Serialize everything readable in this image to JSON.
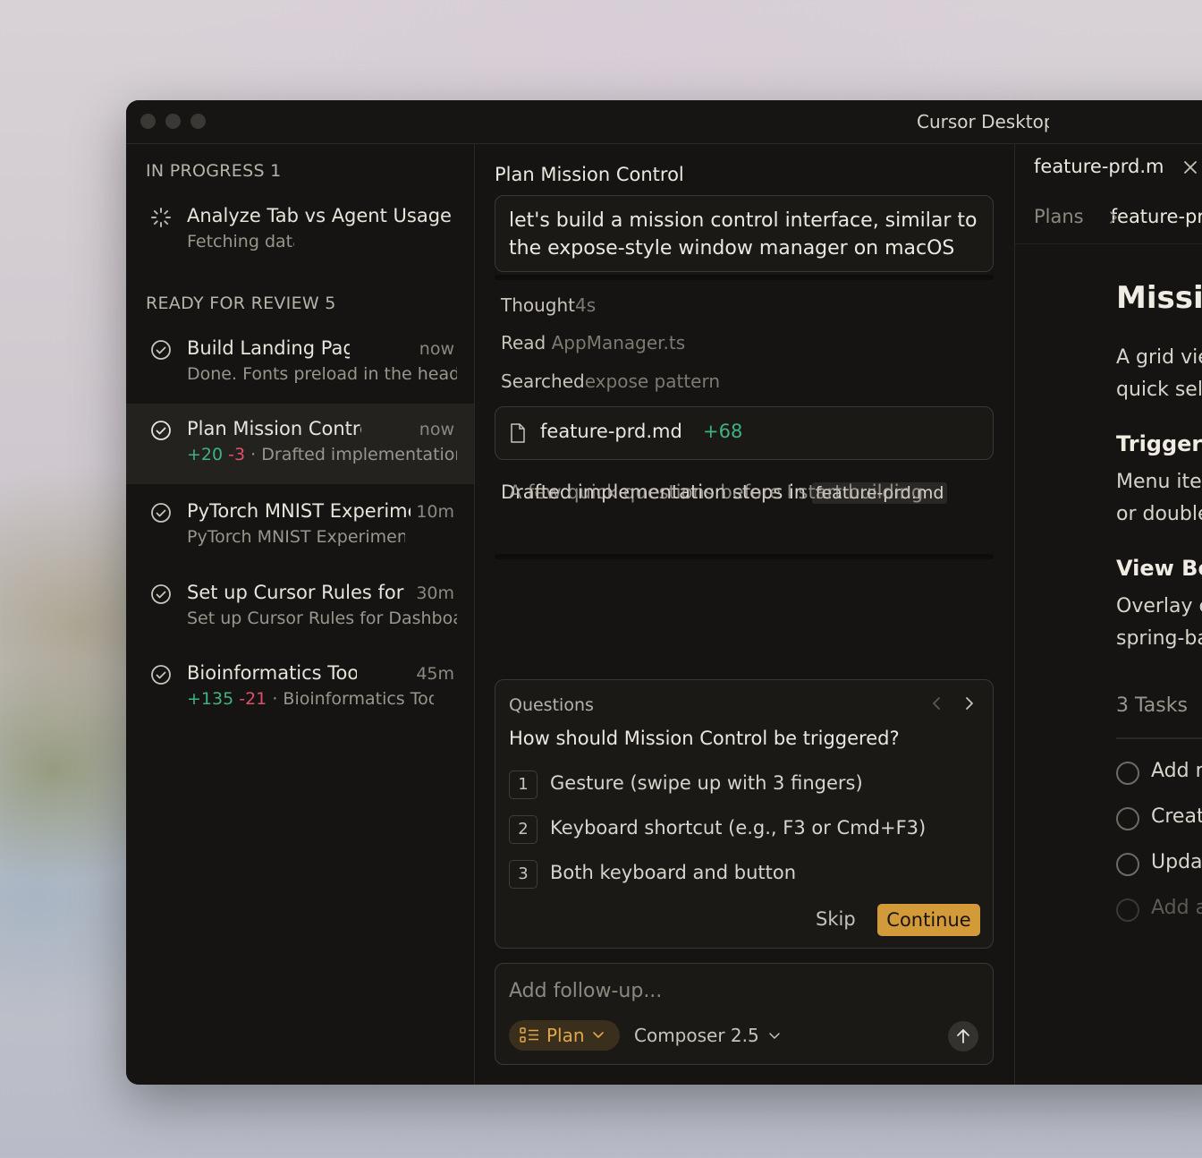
{
  "window": {
    "title": "Cursor Desktop"
  },
  "sidebar": {
    "in_progress": {
      "heading": "IN PROGRESS 1",
      "items": [
        {
          "title": "Analyze Tab vs Agent Usage P",
          "subtitle": "Fetching data"
        }
      ]
    },
    "ready_for_review": {
      "heading": "READY FOR REVIEW 5",
      "items": [
        {
          "title": "Build Landing Page",
          "time": "now",
          "subtitle": "Done. Fonts preload in the head,"
        },
        {
          "title": "Plan Mission Control",
          "time": "now",
          "added": "+20",
          "removed": "-3",
          "sep": "·",
          "subtitle": "Drafted implementation"
        },
        {
          "title": "PyTorch MNIST Experiment",
          "time": "10m",
          "subtitle": "PyTorch MNIST Experiment"
        },
        {
          "title": "Set up Cursor Rules for Dashboard",
          "time": "30m",
          "subtitle": "Set up Cursor Rules for Dashboard"
        },
        {
          "title": "Bioinformatics Tools",
          "time": "45m",
          "added": "+135",
          "removed": "-21",
          "sep": "·",
          "subtitle": "Bioinformatics Tools"
        }
      ]
    }
  },
  "chat": {
    "title": "Plan Mission Control",
    "prompt": "let's build a mission control interface, similar to the expose-style window manager on macOS",
    "steps": [
      {
        "label": "Thought",
        "detail": "4s"
      },
      {
        "label": "Read",
        "detail": "AppManager.ts"
      },
      {
        "label": "Searched",
        "detail": "expose pattern"
      }
    ],
    "file": {
      "name": "feature-prd.md",
      "added": "+68"
    },
    "status_line_a": "Drafted implementation steps in",
    "status_line_b": "A few quick questions before I start building",
    "status_file": "feature-prd.md",
    "questions": {
      "label": "Questions",
      "question": "How should Mission Control be triggered?",
      "options": [
        {
          "num": "1",
          "text": "Gesture (swipe up with 3 fingers)"
        },
        {
          "num": "2",
          "text": "Keyboard shortcut (e.g., F3 or Cmd+F3)"
        },
        {
          "num": "3",
          "text": "Both keyboard and button"
        }
      ],
      "skip": "Skip",
      "continue": "Continue"
    },
    "followup": {
      "placeholder": "Add follow-up...",
      "mode": "Plan",
      "model": "Composer 2.5"
    }
  },
  "doc": {
    "tab": "feature-prd.md",
    "breadcrumb": [
      "Plans",
      "feature-prd.md"
    ],
    "title": "Mission Control",
    "intro_1": "A grid view",
    "intro_2": "quick select",
    "h_trigger": "Trigger",
    "trigger_1": "Menu item",
    "trigger_2": "or double",
    "h_view": "View Behavior",
    "view_1": "Overlay e",
    "view_2": "spring-ba",
    "tasks_heading": "3 Tasks",
    "tasks": [
      "Add menu",
      "Create",
      "Update",
      "Add a"
    ]
  },
  "colors": {
    "accent": "#d39a3a",
    "added": "#3fb37f",
    "removed": "#e0506a",
    "window_bg": "#151412"
  }
}
